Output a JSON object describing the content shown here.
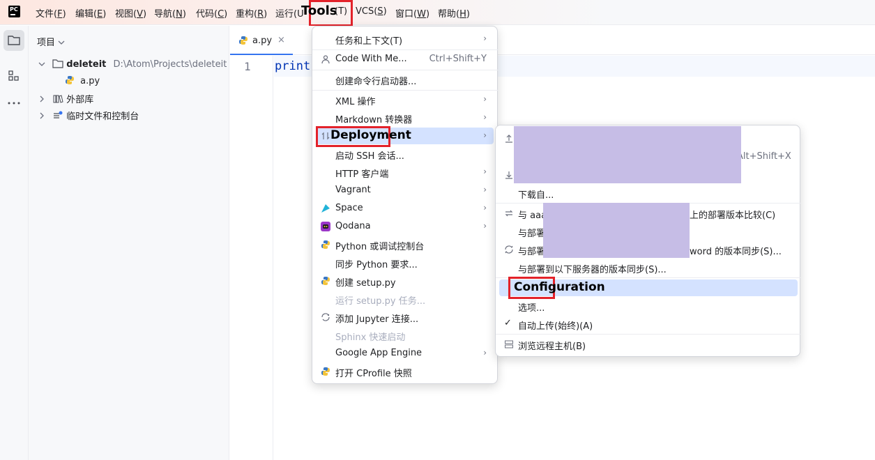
{
  "menubar": {
    "logo": "PC",
    "items": [
      {
        "label": "文件(",
        "key": "F",
        "end": ")"
      },
      {
        "label": "编辑(",
        "key": "E",
        "end": ")"
      },
      {
        "label": "视图(",
        "key": "V",
        "end": ")"
      },
      {
        "label": "导航(",
        "key": "N",
        "end": ")"
      },
      {
        "label": "代码(",
        "key": "C",
        "end": ")"
      },
      {
        "label": "重构(",
        "key": "R",
        "end": ")"
      },
      {
        "label": "运行(U",
        "key": "",
        "end": ""
      },
      {
        "label": "VCS(",
        "key": "S",
        "end": ")"
      },
      {
        "label": "窗口(",
        "key": "W",
        "end": ")"
      },
      {
        "label": "帮助(",
        "key": "H",
        "end": ")"
      }
    ],
    "tools_label": "Tools",
    "tools_suffix": "(T)"
  },
  "project_panel": {
    "title": "项目",
    "tree": [
      {
        "name": "deleteit",
        "path": "D:\\Atom\\Projects\\deleteit"
      },
      {
        "name": "a.py"
      },
      {
        "name": "外部库"
      },
      {
        "name": "临时文件和控制台"
      }
    ]
  },
  "editor": {
    "tab_label": "a.py",
    "tab_close": "×",
    "line_number": "1",
    "code": "print"
  },
  "tools_menu": {
    "items": [
      {
        "label": "任务和上下文(T)",
        "arrow": "›"
      },
      {
        "label": "Code With Me...",
        "shortcut": "Ctrl+Shift+Y"
      },
      {
        "label": "创建命令行启动器..."
      },
      {
        "label": "XML 操作",
        "arrow": "›"
      },
      {
        "label": "Markdown 转换器",
        "arrow": "›"
      },
      {
        "label": "Deployment",
        "arrow": "›"
      },
      {
        "label": "启动 SSH 会话..."
      },
      {
        "label": "HTTP 客户端",
        "arrow": "›"
      },
      {
        "label": "Vagrant",
        "arrow": "›"
      },
      {
        "label": "Space",
        "arrow": "›"
      },
      {
        "label": "Qodana",
        "arrow": "›"
      },
      {
        "label": "Python 或调试控制台"
      },
      {
        "label": "同步 Python 要求..."
      },
      {
        "label": "创建 setup.py"
      },
      {
        "label": "运行 setup.py 任务..."
      },
      {
        "label": "添加 Jupyter 连接..."
      },
      {
        "label": "Sphinx 快速启动"
      },
      {
        "label": "Google App Engine",
        "arrow": "›"
      },
      {
        "label": "打开 CProfile 快照"
      }
    ]
  },
  "deploy_menu": {
    "shortcut_partial": "Alt+Shift+X",
    "download": "下载自...",
    "compare_prefix": "与 aaa",
    "compare_suffix": "上的部署版本比较(C)",
    "deploy2_prefix": "与部署",
    "sync_prefix": "与部署",
    "sync_suffix": "word 的版本同步(S)...",
    "sync_servers": "与部署到以下服务器的版本同步(S)...",
    "configuration": "Configuration",
    "options": "选项...",
    "auto_upload": "自动上传(始终)(A)",
    "check_mark": "✓",
    "browse_remote": "浏览远程主机(B)"
  }
}
